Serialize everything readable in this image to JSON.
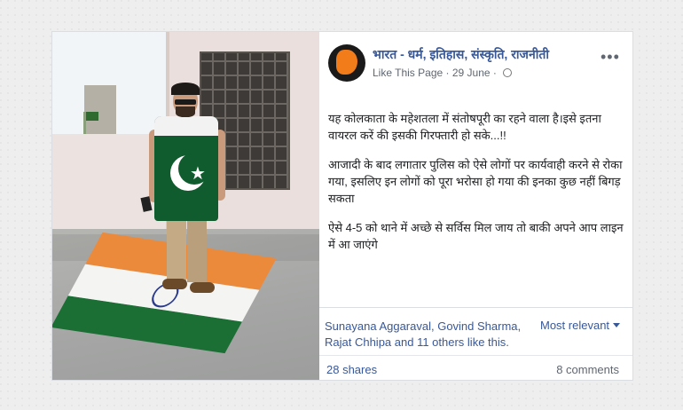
{
  "post": {
    "page_name": "भारत - धर्म, इतिहास, संस्कृति, राजनीती",
    "like_link": "Like This Page",
    "separator": "·",
    "date": "29 June",
    "more_icon": "more-options-icon",
    "globe_icon": "globe-icon",
    "paragraphs": [
      "यह कोलकाता के महेशतला में संतोषपूरी का रहने वाला है।इसे इतना वायरल करें की इसकी गिरफ्तारी हो सके...!!",
      "आजादी के बाद लगातार पुलिस को ऐसे लोगों पर कार्यवाही करने से रोका गया, इसलिए इन लोगों को पूरा भरोसा हो गया की इनका कुछ नहीं बिगड़ सकता",
      "ऐसे 4-5 को थाने में अच्छे से सर्विस मिल जाय तो बाकी अपने आप लाइन में आ जाएंगे"
    ]
  },
  "reactions": {
    "likes_text": "Sunayana Aggaraval, Govind Sharma, Rajat Chhipa and 11 others like this.",
    "sort_label": "Most relevant",
    "shares": "28 shares",
    "comments": "8 comments"
  },
  "colors": {
    "link": "#385898",
    "secondary": "#606770",
    "text": "#1c1e21"
  }
}
